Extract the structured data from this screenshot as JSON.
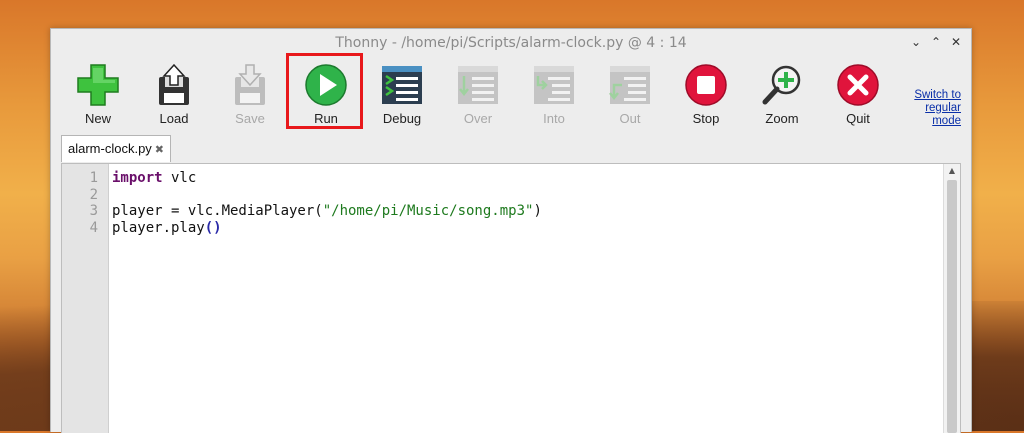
{
  "window": {
    "title": "Thonny  -  /home/pi/Scripts/alarm-clock.py  @  4 : 14"
  },
  "window_controls": [
    "⌄",
    "⌃",
    "✕"
  ],
  "toolbar": {
    "buttons": [
      {
        "label": "New",
        "icon": "new-icon",
        "enabled": true
      },
      {
        "label": "Load",
        "icon": "load-icon",
        "enabled": true
      },
      {
        "label": "Save",
        "icon": "save-icon",
        "enabled": false
      },
      {
        "label": "Run",
        "icon": "run-icon",
        "enabled": true
      },
      {
        "label": "Debug",
        "icon": "debug-icon",
        "enabled": true
      },
      {
        "label": "Over",
        "icon": "step-over-icon",
        "enabled": false
      },
      {
        "label": "Into",
        "icon": "step-into-icon",
        "enabled": false
      },
      {
        "label": "Out",
        "icon": "step-out-icon",
        "enabled": false
      },
      {
        "label": "Stop",
        "icon": "stop-icon",
        "enabled": true
      },
      {
        "label": "Zoom",
        "icon": "zoom-icon",
        "enabled": true
      },
      {
        "label": "Quit",
        "icon": "quit-icon",
        "enabled": true
      }
    ],
    "switch_mode_link": "Switch to regular mode"
  },
  "tabs": [
    {
      "label": "alarm-clock.py",
      "close": "✖"
    }
  ],
  "editor": {
    "line_numbers": [
      "1",
      "2",
      "3",
      "4"
    ],
    "lines": {
      "l1_kw": "import",
      "l1_rest": " vlc",
      "l3_pre": "player = vlc.MediaPlayer(",
      "l3_str": "\"/home/pi/Music/song.mp3\"",
      "l3_post": ")",
      "l4_pre": "player.play",
      "l4_paren": "()"
    }
  },
  "colors": {
    "accent_highlight": "#e8181b",
    "run_green": "#2fb34a",
    "stop_red": "#e0143c",
    "link_blue": "#0a2fa8"
  }
}
